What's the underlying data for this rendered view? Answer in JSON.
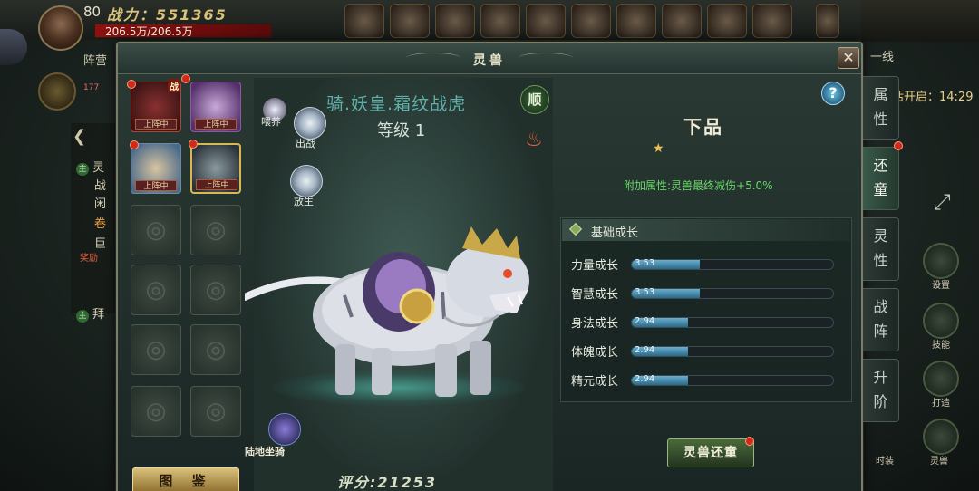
{
  "hud": {
    "level": "80",
    "power": "战力：551365",
    "hp": "206.5万/206.5万",
    "camp": "阵营",
    "mini_value": "177",
    "quest_lines": [
      "灵",
      "战",
      "闲",
      "卷",
      "巨",
      "拜"
    ],
    "reward": "奖励",
    "line": "一线",
    "open_time": "活开启：14:29",
    "right_buttons": [
      "设置",
      "技能",
      "打造",
      "时装",
      "灵兽"
    ]
  },
  "panel": {
    "title": "灵兽",
    "close": "✕"
  },
  "slots": {
    "deploy_label": "上阵中",
    "battle_label": "战"
  },
  "tujian_label": "图 鉴",
  "pet": {
    "name": "骑.妖皇.霜纹战虎",
    "level": "等级 1",
    "actions": {
      "feed": "喂养",
      "battle": "出战",
      "release": "放生",
      "shun": "顺"
    },
    "mount_label": "陆地坐骑",
    "score": "评分:21253"
  },
  "info": {
    "help": "?",
    "grade": "下品",
    "stars": "★",
    "bonus": "附加属性:灵兽最终减伤+5.0%",
    "growth_title": "基础成长",
    "stats": [
      {
        "label": "力量成长",
        "value": "3.53",
        "fill": 0.34
      },
      {
        "label": "智慧成长",
        "value": "3.53",
        "fill": 0.34
      },
      {
        "label": "身法成长",
        "value": "2.94",
        "fill": 0.28
      },
      {
        "label": "体魄成长",
        "value": "2.94",
        "fill": 0.28
      },
      {
        "label": "精元成长",
        "value": "2.94",
        "fill": 0.28
      }
    ],
    "restore_button": "灵兽还童"
  },
  "tabs": [
    "属性",
    "还童",
    "灵性",
    "战阵",
    "升阶"
  ],
  "active_tab": 1
}
